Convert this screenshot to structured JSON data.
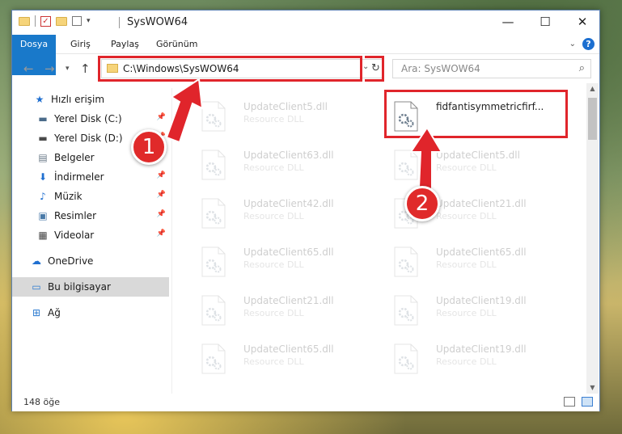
{
  "window": {
    "title": "SysWOW64",
    "controls": {
      "minimize": "—",
      "maximize": "☐",
      "close": "✕"
    }
  },
  "ribbon": {
    "tabs": [
      "Dosya",
      "Giriş",
      "Paylaş",
      "Görünüm"
    ],
    "help": "?"
  },
  "address": {
    "path": "C:\\Windows\\SysWOW64",
    "search_placeholder": "Ara: SysWOW64"
  },
  "sidebar": {
    "items": [
      {
        "label": "Hızlı erişim",
        "icon": "star-icon",
        "glyph": "★",
        "color": "#1f6fd0",
        "pinned": false
      },
      {
        "label": "Yerel Disk (C:)",
        "icon": "drive-icon",
        "glyph": "▬",
        "color": "#4a6b8a",
        "pinned": true
      },
      {
        "label": "Yerel Disk (D:)",
        "icon": "drive-icon",
        "glyph": "▬",
        "color": "#4a4a4a",
        "pinned": true
      },
      {
        "label": "Belgeler",
        "icon": "documents-icon",
        "glyph": "▤",
        "color": "#6a7a88",
        "pinned": true
      },
      {
        "label": "İndirmeler",
        "icon": "download-icon",
        "glyph": "⬇",
        "color": "#1f6fd0",
        "pinned": true
      },
      {
        "label": "Müzik",
        "icon": "music-icon",
        "glyph": "♪",
        "color": "#1f6fd0",
        "pinned": true
      },
      {
        "label": "Resimler",
        "icon": "pictures-icon",
        "glyph": "▣",
        "color": "#4a7aa8",
        "pinned": true
      },
      {
        "label": "Videolar",
        "icon": "video-icon",
        "glyph": "▦",
        "color": "#444",
        "pinned": true
      },
      {
        "label": "OneDrive",
        "icon": "cloud-icon",
        "glyph": "☁",
        "color": "#1f6fd0",
        "pinned": false
      },
      {
        "label": "Bu bilgisayar",
        "icon": "computer-icon",
        "glyph": "▭",
        "color": "#2a7ad0",
        "pinned": false,
        "selected": true
      },
      {
        "label": "Ağ",
        "icon": "network-icon",
        "glyph": "⊞",
        "color": "#2a7ad0",
        "pinned": false
      }
    ]
  },
  "files": [
    {
      "name": "UpdateClient5.dll",
      "type": "Resource DLL",
      "faded": true
    },
    {
      "name": "fidfantisymmetricfirf...",
      "type": "",
      "faded": false,
      "highlighted": true
    },
    {
      "name": "UpdateClient63.dll",
      "type": "Resource DLL",
      "faded": true
    },
    {
      "name": "UpdateClient5.dll",
      "type": "Resource DLL",
      "faded": true
    },
    {
      "name": "UpdateClient42.dll",
      "type": "Resource DLL",
      "faded": true
    },
    {
      "name": "UpdateClient21.dll",
      "type": "Resource DLL",
      "faded": true
    },
    {
      "name": "UpdateClient65.dll",
      "type": "Resource DLL",
      "faded": true
    },
    {
      "name": "UpdateClient65.dll",
      "type": "Resource DLL",
      "faded": true
    },
    {
      "name": "UpdateClient21.dll",
      "type": "Resource DLL",
      "faded": true
    },
    {
      "name": "UpdateClient19.dll",
      "type": "Resource DLL",
      "faded": true
    },
    {
      "name": "UpdateClient65.dll",
      "type": "Resource DLL",
      "faded": true
    },
    {
      "name": "UpdateClient19.dll",
      "type": "Resource DLL",
      "faded": true
    }
  ],
  "status": {
    "count": "148 öğe"
  },
  "annotations": {
    "step1": "1",
    "step2": "2",
    "color": "#e0252b"
  }
}
